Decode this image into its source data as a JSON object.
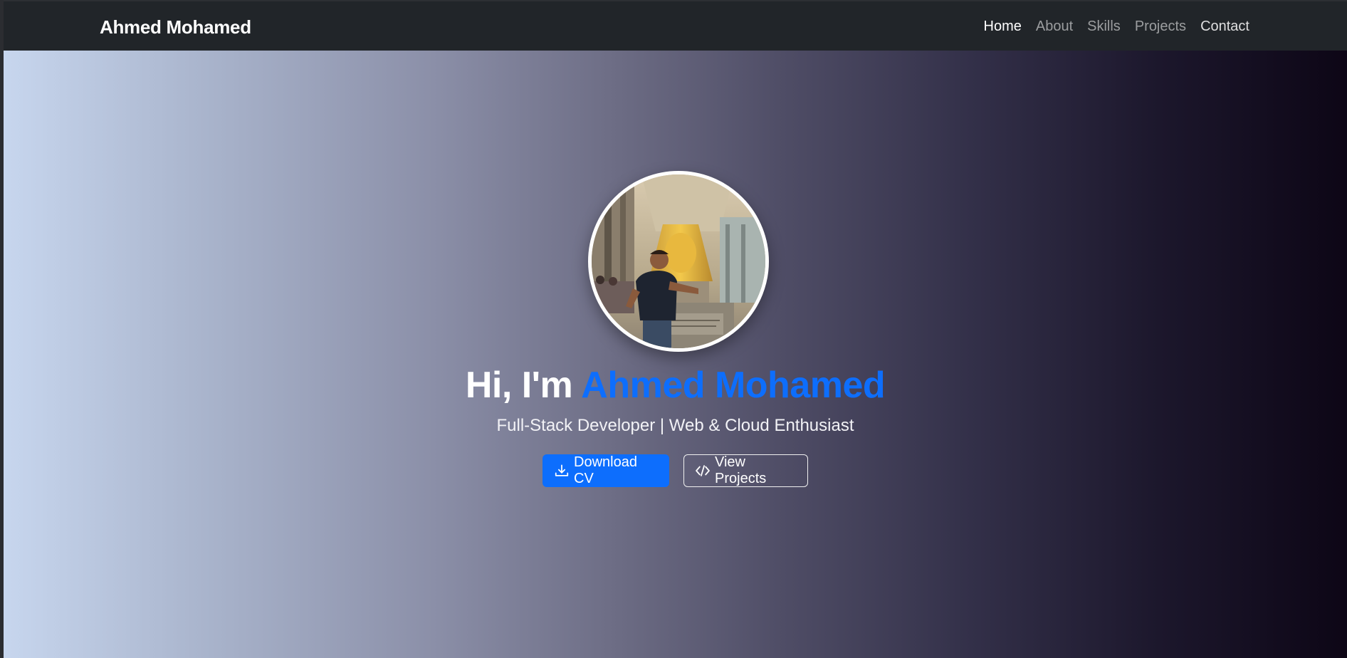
{
  "navbar": {
    "brand": "Ahmed Mohamed",
    "links": [
      {
        "label": "Home"
      },
      {
        "label": "About"
      },
      {
        "label": "Skills"
      },
      {
        "label": "Projects"
      },
      {
        "label": "Contact"
      }
    ]
  },
  "hero": {
    "avatar_icon": "profile-photo",
    "greeting": "Hi, I'm ",
    "name": "Ahmed Mohamed",
    "subtitle": "Full-Stack Developer | Web & Cloud Enthusiast",
    "buttons": {
      "download": {
        "label": "Download CV",
        "icon": "download-icon"
      },
      "projects": {
        "label": "View Projects",
        "icon": "code-icon"
      }
    }
  },
  "colors": {
    "accent": "#0d6efd",
    "navbar_bg": "#212529",
    "gradient_start": "#c7d6ee",
    "gradient_end": "#0d0616"
  }
}
